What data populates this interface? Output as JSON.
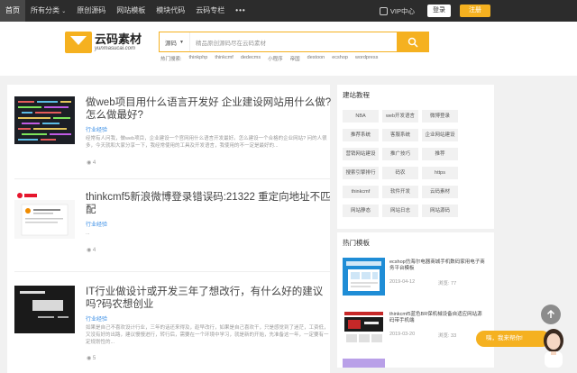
{
  "nav": {
    "items": [
      "首页",
      "所有分类",
      "原创源码",
      "网站模板",
      "模块代码",
      "云码专栏"
    ],
    "more": "•••",
    "vip": "VIP中心",
    "login": "登录",
    "register": "注册"
  },
  "logo": {
    "cn": "云码素材",
    "en": "yunmasucai.com"
  },
  "search": {
    "type": "源码",
    "placeholder": "精品原创源码尽在云码素材",
    "hot_label": "热门搜索:",
    "hot": [
      "thinkphp",
      "thinkcmf",
      "dedecms",
      "小程序",
      "帝国",
      "destoon",
      "ecshop",
      "wordpress"
    ]
  },
  "posts": [
    {
      "title": "做web项目用什么语言开发好 企业建设网站用什么做?怎么做最好?",
      "tag": "行业经验",
      "desc": "经常有人问我，做web项目，企业建设一个官网用什么语言开发最好。怎么建设一个合格的企业网站? 问的人很多，今天就和大家分享一下，我经常使用的工具及开发语言，我使用的不一定是最好的...",
      "views": "4"
    },
    {
      "title": "thinkcmf5新浪微博登录错误码:21322 重定向地址不匹配",
      "tag": "行业经验",
      "desc": "...",
      "views": "4"
    },
    {
      "title": "IT行业做设计或开发三年了想改行，有什么好的建议吗?码农想创业",
      "tag": "行业经验",
      "desc": "如果是自己不喜欢设计行业，三年的话还来得及，趁早改行，如果是自己喜欢干，只是感觉到了迷茫，工资低，又没有好的出路，建议慢慢进行，转行后，需要在一个环境中学习，就是新的开始，先准备这一年，一定要有一定规划性的...",
      "views": "5"
    }
  ],
  "sidebar": {
    "tags_title": "建站教程",
    "tags": [
      "NBA",
      "web开发语言",
      "微博登录",
      "推荐系统",
      "客服系统",
      "企业网站建设",
      "营销网站建设",
      "推广技巧",
      "推荐",
      "搜索引擎排行",
      "码农",
      "https",
      "thinkcmf",
      "软件开发",
      "云码素材",
      "网站静态",
      "网站日志",
      "网站源码"
    ],
    "hot_title": "热门模板",
    "hot": [
      {
        "title": "ecshop仿海尔电器商城手机数码家用电子商务平台模板",
        "date": "2019-04-12",
        "views": "浏览: 77"
      },
      {
        "title": "thinkcmf5蓝色BR保机械设备自适应网站源码带手机端",
        "date": "2019-03-20",
        "views": "浏览: 33"
      }
    ]
  },
  "help": "嗨，我来帮你!",
  "colors": {
    "accent": "#f5b120",
    "dark": "#2c2c2c",
    "link": "#3a8ee6"
  }
}
